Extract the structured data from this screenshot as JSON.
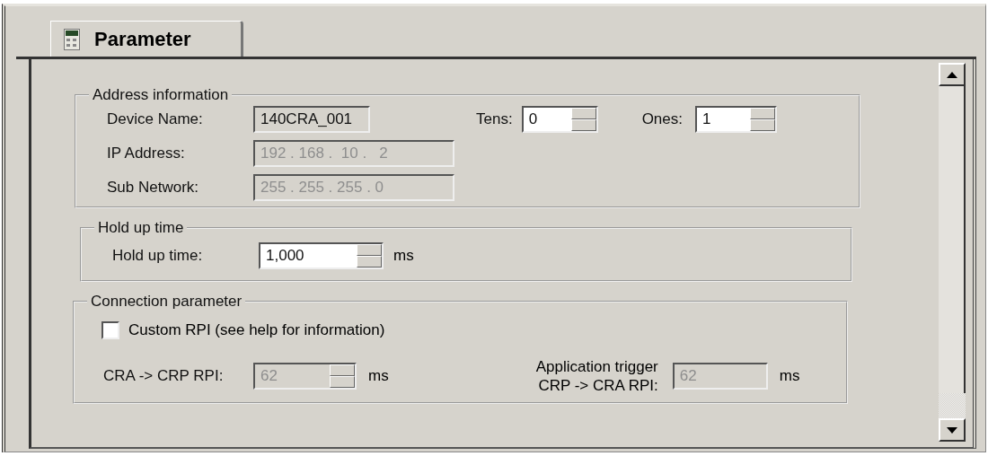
{
  "tab": {
    "label": "Parameter",
    "selected": true
  },
  "address": {
    "title": "Address information",
    "rows": [
      {
        "label": "Device Name:",
        "kind": "readonly",
        "value": "140CRA_001",
        "disabled": false
      },
      {
        "label": "IP Address:",
        "kind": "text",
        "value": "192 . 168 .  10 .   2",
        "disabled": true
      },
      {
        "label": "Sub Network:",
        "kind": "text",
        "value": "255 . 255 . 255 . 0",
        "disabled": true
      }
    ],
    "tens": {
      "label": "Tens:",
      "value": "0",
      "disabled": false
    },
    "ones": {
      "label": "Ones:",
      "value": "1",
      "disabled": false
    }
  },
  "hold": {
    "title": "Hold up time",
    "label": "Hold up time:",
    "value": "1,000",
    "disabled": false,
    "unit": "ms"
  },
  "connection": {
    "title": "Connection parameter",
    "custom": {
      "label": "Custom RPI (see help for information)",
      "checked": false
    },
    "cra": {
      "label": "CRA -> CRP RPI:",
      "value": "62",
      "disabled": true,
      "unit": "ms"
    },
    "app": {
      "label_lines": [
        "Application trigger",
        "CRP -> CRA RPI:"
      ],
      "value": "62",
      "disabled": true,
      "unit": "ms"
    }
  }
}
